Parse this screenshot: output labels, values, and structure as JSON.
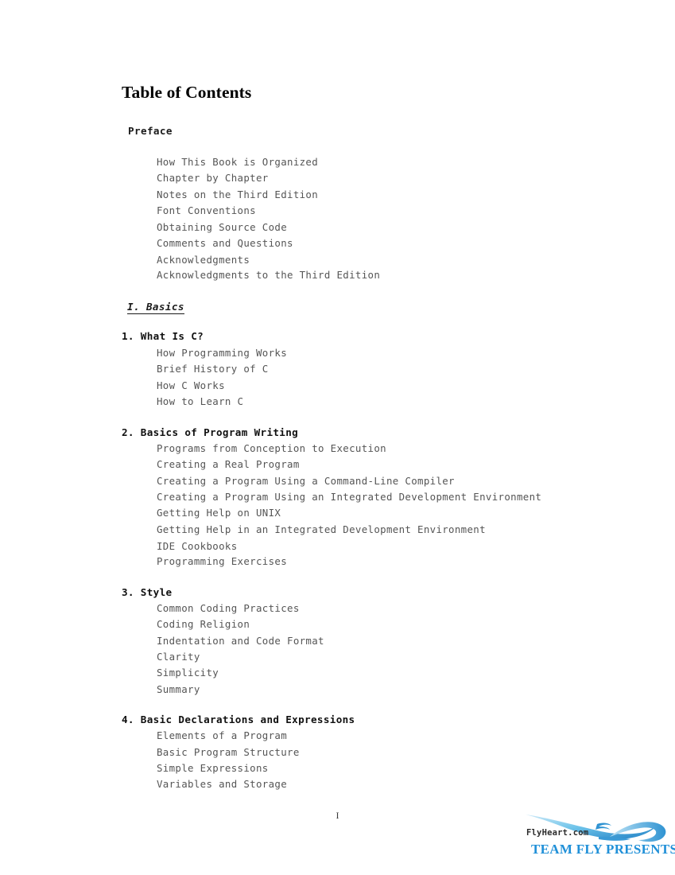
{
  "document": {
    "title": "Table of Contents",
    "page_number": "I"
  },
  "toc": {
    "preface": {
      "label": "Preface",
      "entries": [
        "How This Book is Organized",
        "Chapter by Chapter",
        "Notes on the Third Edition",
        "Font Conventions",
        "Obtaining Source Code",
        "Comments and Questions",
        "Acknowledgments",
        "Acknowledgments to the Third Edition"
      ]
    },
    "parts": [
      {
        "label": "I. Basics",
        "chapters": [
          {
            "label": "1. What Is C?",
            "entries": [
              "How Programming Works",
              "Brief History of C",
              "How C Works",
              "How to Learn C"
            ]
          },
          {
            "label": "2. Basics of Program Writing",
            "entries": [
              "Programs from Conception to Execution",
              "Creating a Real Program",
              "Creating a Program Using a Command-Line Compiler",
              "Creating a Program Using an Integrated Development Environment",
              "Getting Help on UNIX",
              "Getting Help in an Integrated Development Environment",
              "IDE Cookbooks",
              "Programming Exercises"
            ]
          },
          {
            "label": "3. Style",
            "entries": [
              "Common Coding Practices",
              "Coding Religion",
              "Indentation and Code Format",
              "Clarity",
              "Simplicity",
              "Summary"
            ]
          },
          {
            "label": "4. Basic Declarations and Expressions",
            "entries": [
              "Elements of a Program",
              "Basic Program Structure",
              "Simple Expressions",
              "Variables and Storage"
            ]
          }
        ]
      }
    ]
  },
  "footer": {
    "logo_wordmark": "FlyHeart.com",
    "logo_tagline": "TEAM FLY PRESENTS",
    "logo_icon": "swoosh-wave-icon",
    "accent_color": "#2090d8",
    "swoosh_color_light": "#9fd8f2",
    "swoosh_color_dark": "#1f7fc4"
  }
}
